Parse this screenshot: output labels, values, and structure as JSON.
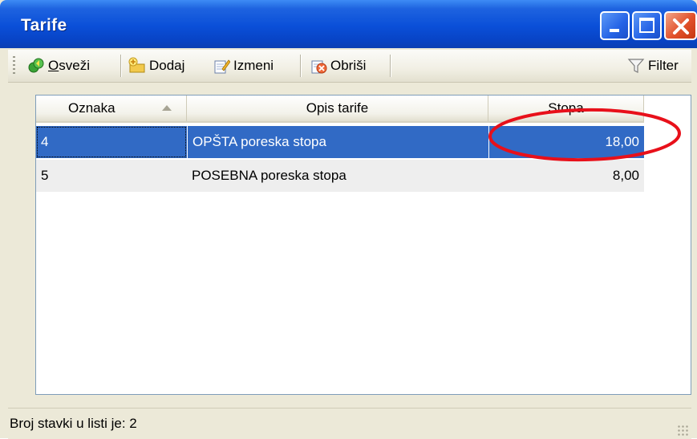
{
  "window": {
    "title": "Tarife",
    "controls": {
      "minimize": "minimize-icon",
      "maximize": "maximize-icon",
      "close": "close-icon"
    }
  },
  "toolbar": {
    "refresh_label_accel": "O",
    "refresh_label_rest": "sveži",
    "add_label": "Dodaj",
    "edit_label": "Izmeni",
    "delete_label": "Obriši",
    "filter_label": "Filter"
  },
  "table": {
    "columns": [
      {
        "label": "Oznaka",
        "sorted": "ascending"
      },
      {
        "label": "Opis tarife"
      },
      {
        "label": "Stopa"
      }
    ],
    "rows": [
      {
        "oznaka": "4",
        "opis": "OPŠTA poreska stopa",
        "stopa": "18,00",
        "selected": true
      },
      {
        "oznaka": "5",
        "opis": "POSEBNA poreska stopa",
        "stopa": "8,00",
        "selected": false
      }
    ]
  },
  "status": {
    "text": "Broj stavki u listi je: 2"
  },
  "colors": {
    "titlebar": "#0a4fd8",
    "selection": "#316ac5",
    "annotation": "#e8101a"
  }
}
